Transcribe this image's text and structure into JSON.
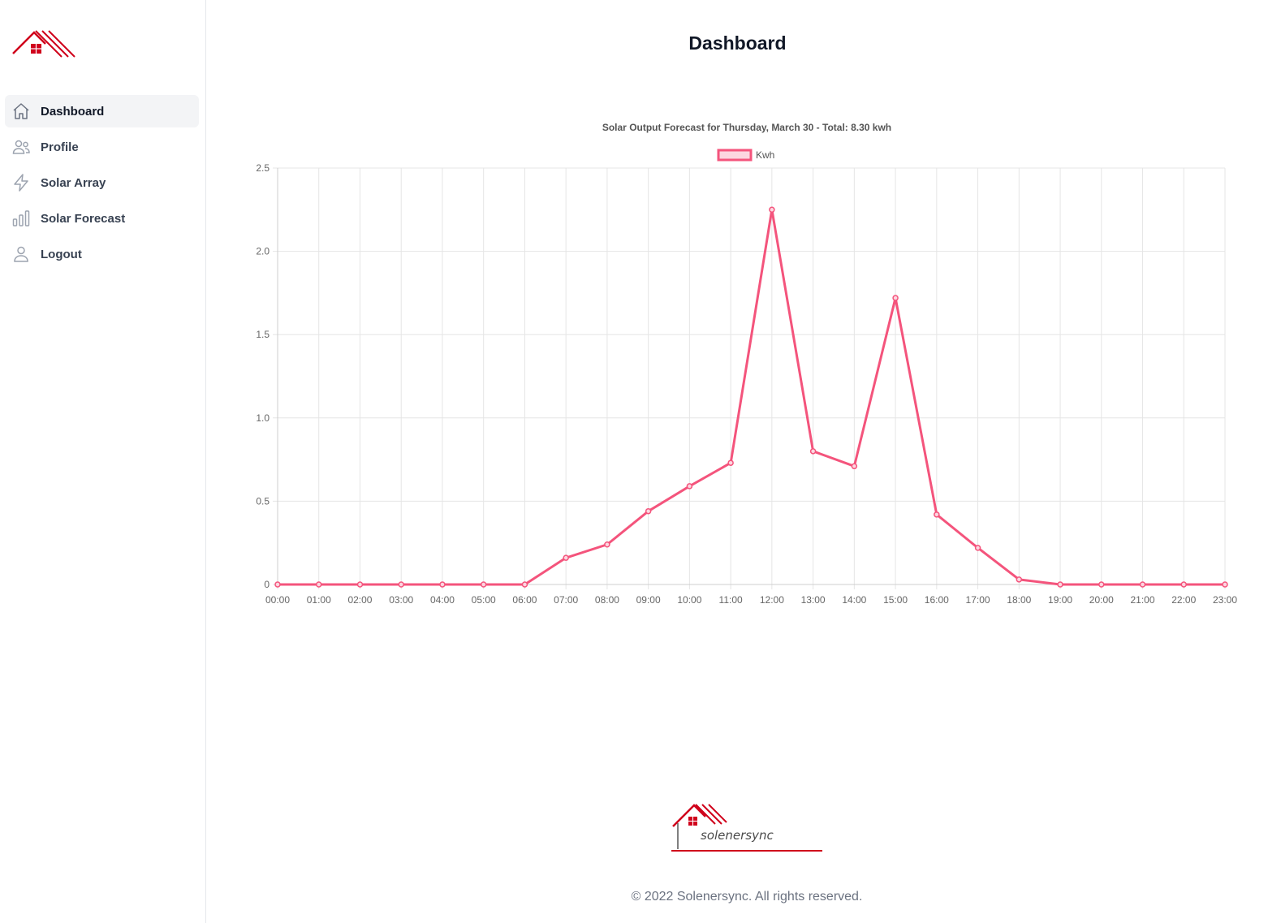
{
  "sidebar": {
    "items": [
      {
        "label": "Dashboard",
        "icon": "home-icon",
        "active": true
      },
      {
        "label": "Profile",
        "icon": "users-icon",
        "active": false
      },
      {
        "label": "Solar Array",
        "icon": "bolt-icon",
        "active": false
      },
      {
        "label": "Solar Forecast",
        "icon": "bar-chart-icon",
        "active": false
      },
      {
        "label": "Logout",
        "icon": "user-icon",
        "active": false
      }
    ]
  },
  "header": {
    "title": "Dashboard"
  },
  "colors": {
    "brand": "#d0021b",
    "line": "#f4547c",
    "fill": "#fcd6e0",
    "grid": "#e5e5e5"
  },
  "chart_data": {
    "type": "line",
    "title": "Solar Output Forecast for Thursday, March 30   -   Total: 8.30 kwh",
    "legend": "top",
    "grid": true,
    "ylim": [
      0,
      2.5
    ],
    "yticks": [
      "0",
      "0.5",
      "1.0",
      "1.5",
      "2.0",
      "2.5"
    ],
    "categories": [
      "00:00",
      "01:00",
      "02:00",
      "03:00",
      "04:00",
      "05:00",
      "06:00",
      "07:00",
      "08:00",
      "09:00",
      "10:00",
      "11:00",
      "12:00",
      "13:00",
      "14:00",
      "15:00",
      "16:00",
      "17:00",
      "18:00",
      "19:00",
      "20:00",
      "21:00",
      "22:00",
      "23:00"
    ],
    "series": [
      {
        "name": "Kwh",
        "values": [
          0,
          0,
          0,
          0,
          0,
          0,
          0,
          0.16,
          0.24,
          0.44,
          0.59,
          0.73,
          2.25,
          0.8,
          0.71,
          1.72,
          0.42,
          0.22,
          0.03,
          0,
          0,
          0,
          0,
          0
        ]
      }
    ]
  },
  "footer": {
    "logo_text": "solenersync",
    "copyright": "© 2022 Solenersync. All rights reserved."
  }
}
